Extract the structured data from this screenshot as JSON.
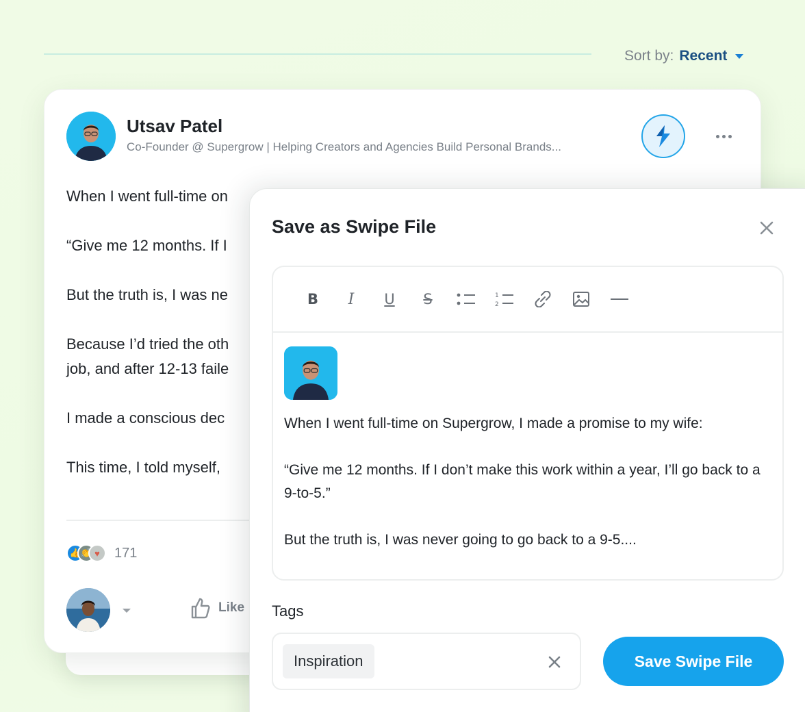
{
  "sort": {
    "label": "Sort by:",
    "value": "Recent"
  },
  "post": {
    "author_name": "Utsav Patel",
    "author_headline": "Co-Founder @ Supergrow | Helping Creators and Agencies Build Personal Brands...",
    "body": [
      "When I went full-time on",
      "“Give me 12 months. If I",
      "But the truth is, I was ne",
      "Because I’d tried the oth",
      "job, and after 12-13 faile",
      "I made a conscious dec",
      "This time, I told myself,"
    ],
    "reaction_count": "171",
    "like_label": "Like"
  },
  "modal": {
    "title": "Save as Swipe File",
    "toolbar": [
      "bold",
      "italic",
      "underline",
      "strikethrough",
      "bullet-list",
      "numbered-list",
      "link",
      "image",
      "horizontal-rule"
    ],
    "content": [
      "When I went full-time on Supergrow, I made a promise to my wife:",
      "“Give me 12 months. If I don’t make this work within a year, I’ll go back to a 9-to-5.”",
      "But the truth is, I was never going to go back to a 9-5...."
    ],
    "tags_label": "Tags",
    "tags": [
      "Inspiration"
    ],
    "save_label": "Save Swipe File"
  },
  "colors": {
    "accent": "#16a3ec",
    "sort_value": "#1a4f82",
    "background": "#f0fbe6"
  }
}
